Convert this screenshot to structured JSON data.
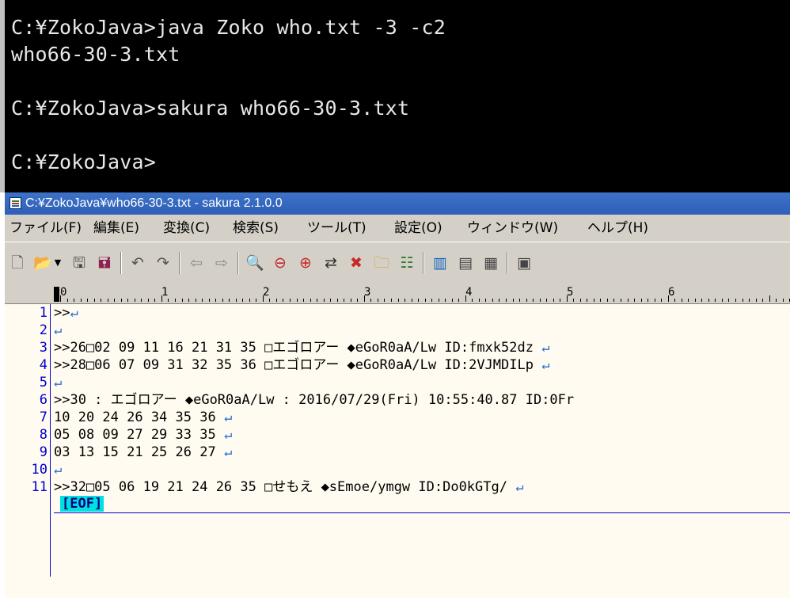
{
  "console": {
    "lines": [
      "C:¥ZokoJava>java Zoko who.txt -3 -c2",
      "who66-30-3.txt",
      "",
      "C:¥ZokoJava>sakura who66-30-3.txt",
      "",
      "C:¥ZokoJava>"
    ]
  },
  "editor_window": {
    "title": "C:¥ZokoJava¥who66-30-3.txt - sakura 2.1.0.0",
    "menu": [
      "ファイル(F)",
      "編集(E)",
      "変換(C)",
      "検索(S)",
      "ツール(T)",
      "設定(O)",
      "ウィンドウ(W)",
      "ヘルプ(H)"
    ],
    "ruler_numbers": [
      "0",
      "1",
      "2",
      "3",
      "4",
      "5",
      "6"
    ],
    "lines": [
      {
        "num": "1",
        "text": ">>"
      },
      {
        "num": "2",
        "text": ""
      },
      {
        "num": "3",
        "text": ">>26□02 09 11 16 21 31 35 □エゴロアー ◆eGoR0aA/Lw ID:fmxk52dz "
      },
      {
        "num": "4",
        "text": ">>28□06 07 09 31 32 35 36 □エゴロアー ◆eGoR0aA/Lw ID:2VJMDILp "
      },
      {
        "num": "5",
        "text": ""
      },
      {
        "num": "6",
        "text": ">>30 : エゴロアー ◆eGoR0aA/Lw : 2016/07/29(Fri) 10:55:40.87 ID:0Fr"
      },
      {
        "num": "7",
        "text": "10 20 24 26 34 35 36 "
      },
      {
        "num": "8",
        "text": "05 08 09 27 29 33 35 "
      },
      {
        "num": "9",
        "text": "03 13 15 21 25 26 27 "
      },
      {
        "num": "10",
        "text": ""
      },
      {
        "num": "11",
        "text": ">>32□05 06 19 21 24 26 35 □せもえ ◆sEmoe/ymgw ID:Do0kGTg/ "
      }
    ],
    "newline_mark": "↵",
    "eof_label": "[EOF]"
  }
}
